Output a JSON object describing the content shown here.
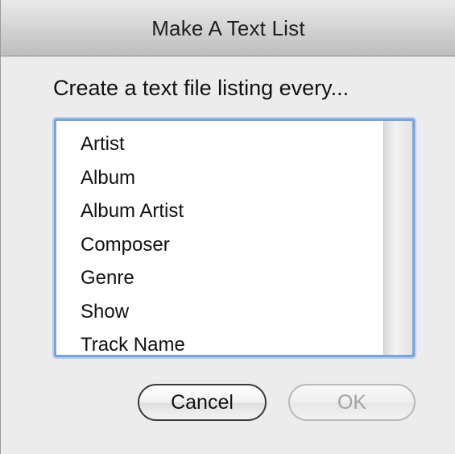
{
  "window": {
    "title": "Make A Text List"
  },
  "prompt": "Create a text file listing every...",
  "list": {
    "items": [
      {
        "label": "Artist"
      },
      {
        "label": "Album"
      },
      {
        "label": "Album Artist"
      },
      {
        "label": "Composer"
      },
      {
        "label": "Genre"
      },
      {
        "label": "Show"
      },
      {
        "label": "Track Name"
      }
    ]
  },
  "buttons": {
    "cancel_label": "Cancel",
    "ok_label": "OK",
    "ok_enabled": false
  },
  "colors": {
    "focus_ring": "#7aa3dc",
    "window_bg": "#ececec",
    "disabled_text": "#a3a3a3"
  }
}
